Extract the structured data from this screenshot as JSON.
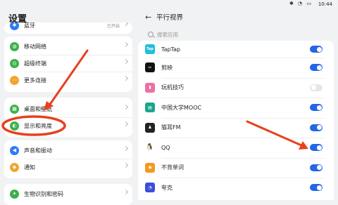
{
  "status_bar": {
    "time": "10:44",
    "icons": "✱ ◔ ▭"
  },
  "settings": {
    "title": "设置",
    "groups": [
      [
        {
          "label": "蓝牙",
          "value": "已开启",
          "color": "#2c7cf6",
          "icon": "bluetooth-icon"
        }
      ],
      [
        {
          "label": "移动网络",
          "color": "#3db04b",
          "icon": "mobile-network-icon"
        },
        {
          "label": "超级终端",
          "color": "#3db04b",
          "icon": "super-device-icon"
        },
        {
          "label": "更多连接",
          "color": "#f1a530",
          "icon": "more-connections-icon"
        }
      ],
      [
        {
          "label": "桌面和壁纸",
          "color": "#3db04b",
          "icon": "wallpaper-icon"
        },
        {
          "label": "显示和亮度",
          "color": "#3db04b",
          "icon": "display-icon"
        }
      ],
      [
        {
          "label": "声音和振动",
          "color": "#2c7cf6",
          "icon": "sound-icon"
        },
        {
          "label": "通知",
          "color": "#f1a530",
          "icon": "notification-icon"
        }
      ],
      [
        {
          "label": "生物识别和密码",
          "color": "#3db04b",
          "icon": "biometric-icon"
        }
      ]
    ]
  },
  "parallel_view": {
    "title": "平行视界",
    "search_placeholder": "搜索应用",
    "apps": [
      {
        "name": "TapTap",
        "on": true,
        "color": "#20c0d8",
        "glyph": "Tap",
        "icon": "taptap-icon"
      },
      {
        "name": "剪映",
        "on": true,
        "color": "#111111",
        "glyph": "✂",
        "icon": "jianying-icon"
      },
      {
        "name": "玩机技巧",
        "on": false,
        "color": "#ee6fa3",
        "glyph": "▮",
        "icon": "tips-icon"
      },
      {
        "name": "中国大学MOOC",
        "on": true,
        "color": "#1aa68c",
        "glyph": "▤",
        "icon": "mooc-icon"
      },
      {
        "name": "猫耳FM",
        "on": true,
        "color": "#222222",
        "glyph": "♟",
        "icon": "maoer-fm-icon"
      },
      {
        "name": "QQ",
        "on": true,
        "color": "#ffffff",
        "glyph": "🐧",
        "icon": "qq-icon"
      },
      {
        "name": "不背单词",
        "on": true,
        "color": "#f39a1e",
        "glyph": "◉",
        "icon": "bubei-icon"
      },
      {
        "name": "夸克",
        "on": true,
        "color": "#3b4ed9",
        "glyph": "◔",
        "icon": "quark-icon"
      }
    ]
  },
  "colors": {
    "accent": "#2565e6",
    "annotation": "#e8401e"
  }
}
